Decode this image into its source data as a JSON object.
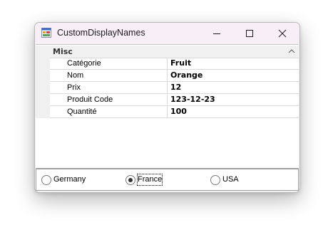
{
  "window": {
    "title": "CustomDisplayNames",
    "icon": "winforms-app-icon"
  },
  "titlebar_buttons": [
    "minimize-icon",
    "maximize-icon",
    "close-icon"
  ],
  "property_grid": {
    "category": "Misc",
    "properties": [
      {
        "name": "Catégorie",
        "value": "Fruit"
      },
      {
        "name": "Nom",
        "value": "Orange"
      },
      {
        "name": "Prix",
        "value": "12"
      },
      {
        "name": "Produit Code",
        "value": "123-12-23"
      },
      {
        "name": "Quantité",
        "value": "100"
      }
    ]
  },
  "radio_group": {
    "options": [
      {
        "label": "Germany",
        "selected": false
      },
      {
        "label": "France",
        "selected": true
      },
      {
        "label": "USA",
        "selected": false
      }
    ]
  }
}
